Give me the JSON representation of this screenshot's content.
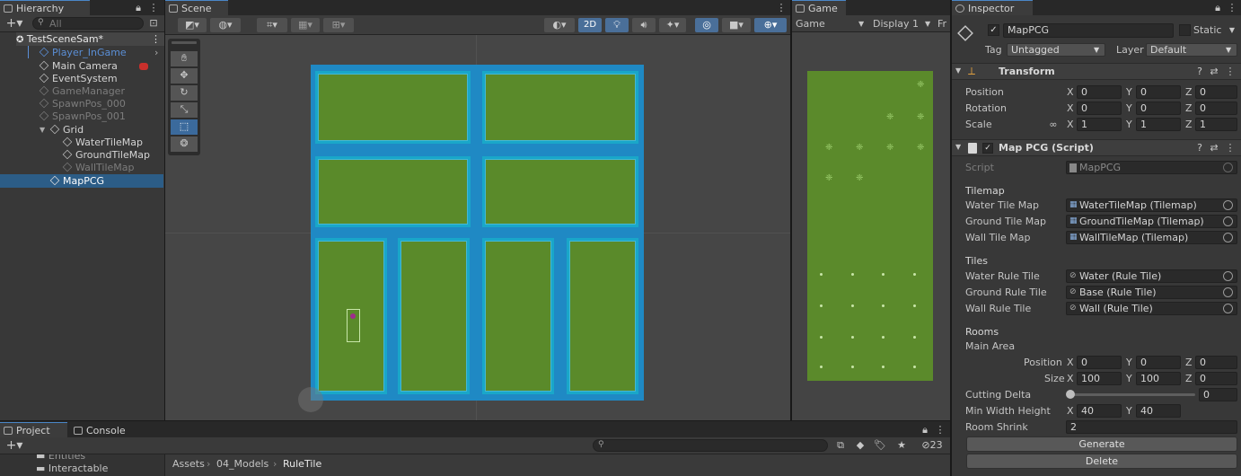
{
  "hierarchy": {
    "tab": "Hierarchy",
    "search_placeholder": "All",
    "scene_name": "TestSceneSam*",
    "items": [
      {
        "label": "Player_InGame",
        "style": "prefab"
      },
      {
        "label": "Main Camera",
        "style": "normal"
      },
      {
        "label": "EventSystem",
        "style": "normal"
      },
      {
        "label": "GameManager",
        "style": "dim"
      },
      {
        "label": "SpawnPos_000",
        "style": "dim"
      },
      {
        "label": "SpawnPos_001",
        "style": "dim"
      },
      {
        "label": "Grid",
        "style": "normal"
      },
      {
        "label": "WaterTileMap",
        "style": "normal"
      },
      {
        "label": "GroundTileMap",
        "style": "normal"
      },
      {
        "label": "WallTileMap",
        "style": "dim"
      },
      {
        "label": "MapPCG",
        "style": "selected"
      }
    ]
  },
  "scene": {
    "tab": "Scene",
    "mode_2d": "2D"
  },
  "game": {
    "tab": "Game",
    "mode": "Game",
    "display": "Display 1",
    "free_aspect": "Fr"
  },
  "project": {
    "tab_project": "Project",
    "tab_console": "Console",
    "folders": [
      "Entities",
      "Interactable"
    ],
    "breadcrumb": [
      "Assets",
      "04_Models",
      "RuleTile"
    ],
    "hidden_count": "23"
  },
  "inspector": {
    "tab": "Inspector",
    "object_name": "MapPCG",
    "static_label": "Static",
    "tag_label": "Tag",
    "tag_value": "Untagged",
    "layer_label": "Layer",
    "layer_value": "Default",
    "transform": {
      "title": "Transform",
      "rows": [
        {
          "label": "Position",
          "x": "0",
          "y": "0",
          "z": "0"
        },
        {
          "label": "Rotation",
          "x": "0",
          "y": "0",
          "z": "0"
        },
        {
          "label": "Scale",
          "x": "1",
          "y": "1",
          "z": "1"
        }
      ]
    },
    "script": {
      "title": "Map PCG (Script)",
      "script_label": "Script",
      "script_value": "MapPCG",
      "tilemap_header": "Tilemap",
      "tilemaps": [
        {
          "label": "Water Tile Map",
          "value": "WaterTileMap (Tilemap)"
        },
        {
          "label": "Ground Tile Map",
          "value": "GroundTileMap (Tilemap)"
        },
        {
          "label": "Wall Tile Map",
          "value": "WallTileMap (Tilemap)"
        }
      ],
      "tiles_header": "Tiles",
      "tiles": [
        {
          "label": "Water Rule Tile",
          "value": "Water (Rule Tile)"
        },
        {
          "label": "Ground Rule Tile",
          "value": "Base (Rule Tile)"
        },
        {
          "label": "Wall Rule Tile",
          "value": "Wall (Rule Tile)"
        }
      ],
      "rooms_header": "Rooms",
      "main_area_label": "Main Area",
      "main_position": {
        "label": "Position",
        "x": "0",
        "y": "0",
        "z": "0"
      },
      "main_size": {
        "label": "Size",
        "x": "100",
        "y": "100",
        "z": "0"
      },
      "cutting_delta_label": "Cutting Delta",
      "cutting_delta_value": "0",
      "cutting_delta_fraction": 0,
      "min_wh_label": "Min Width Height",
      "min_wh_x": "40",
      "min_wh_y": "40",
      "room_shrink_label": "Room Shrink",
      "room_shrink_value": "2",
      "generate_label": "Generate",
      "delete_label": "Delete"
    }
  },
  "axes": {
    "x": "X",
    "y": "Y",
    "z": "Z"
  }
}
